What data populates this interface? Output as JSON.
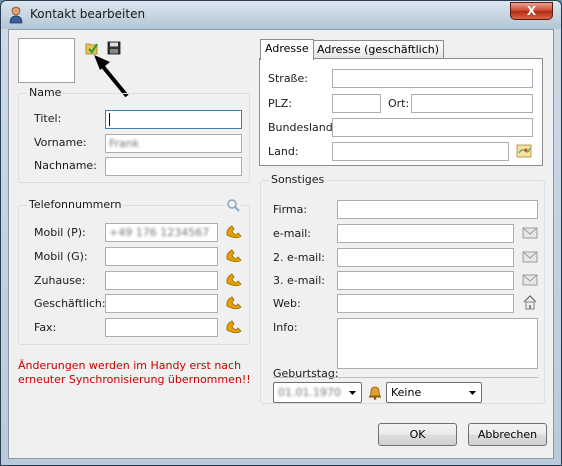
{
  "window": {
    "title": "Kontakt bearbeiten",
    "close_symbol": "X"
  },
  "name_group": {
    "title": "Name",
    "fields": [
      {
        "label": "Titel:",
        "value": ""
      },
      {
        "label": "Vorname:",
        "value": "Frank"
      },
      {
        "label": "Nachname:",
        "value": ""
      }
    ]
  },
  "phone_group": {
    "title": "Telefonnummern",
    "fields": [
      {
        "label": "Mobil (P):",
        "value": "+49 176 1234567"
      },
      {
        "label": "Mobil (G):",
        "value": ""
      },
      {
        "label": "Zuhause:",
        "value": ""
      },
      {
        "label": "Geschäftlich:",
        "value": ""
      },
      {
        "label": "Fax:",
        "value": ""
      }
    ]
  },
  "warning": {
    "line1": "Änderungen werden im Handy erst nach",
    "line2": "erneuter Synchronisierung übernommen!!"
  },
  "address_tabs": {
    "tabs": [
      "Adresse",
      "Adresse (geschäftlich)"
    ],
    "fields": {
      "street": {
        "label": "Straße:",
        "value": ""
      },
      "zip": {
        "label": "PLZ:",
        "value": ""
      },
      "city": {
        "label": "Ort:",
        "value": ""
      },
      "state": {
        "label": "Bundesland:",
        "value": ""
      },
      "country": {
        "label": "Land:",
        "value": ""
      }
    }
  },
  "misc_group": {
    "title": "Sonstiges",
    "fields": [
      {
        "label": "Firma:",
        "value": ""
      },
      {
        "label": "e-mail:",
        "value": ""
      },
      {
        "label": "2. e-mail:",
        "value": ""
      },
      {
        "label": "3. e-mail:",
        "value": ""
      },
      {
        "label": "Web:",
        "value": ""
      }
    ],
    "info_label": "Info:",
    "info_value": "",
    "birthday_label": "Geburtstag:",
    "birthday_value": "01.01.1970",
    "reminder_value": "Keine"
  },
  "buttons": {
    "ok": "OK",
    "cancel": "Abbrechen"
  },
  "colors": {
    "warning": "#c80000",
    "phone_icon": "#e8a000",
    "focus_border": "#3c7fb1"
  }
}
